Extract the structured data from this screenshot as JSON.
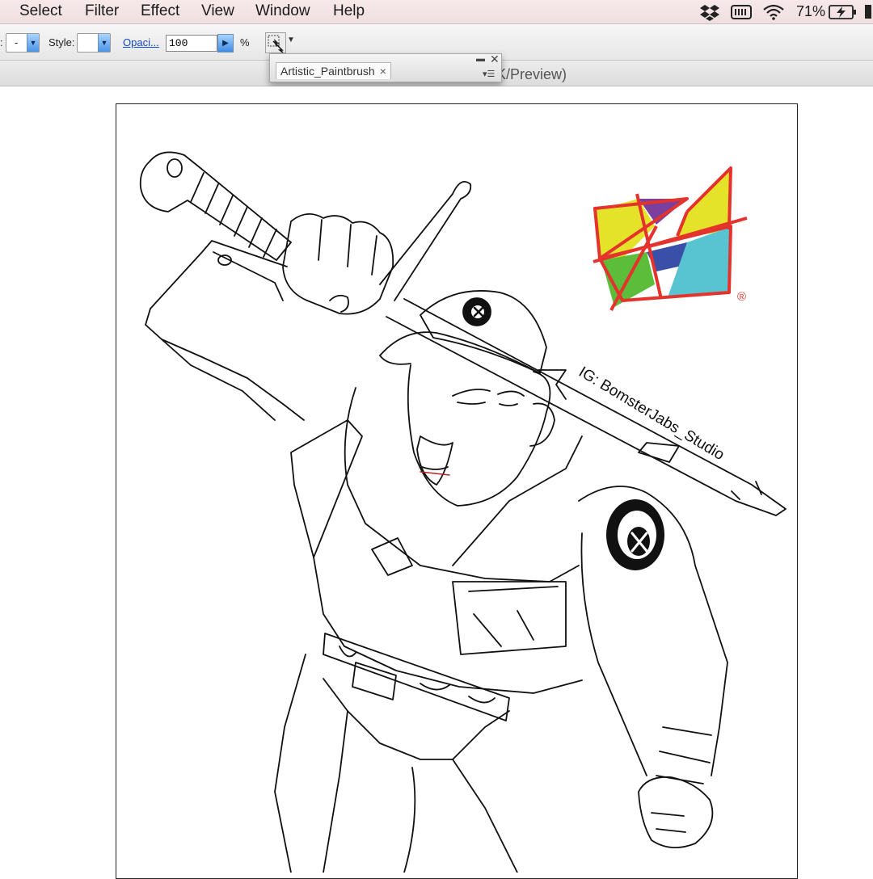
{
  "menubar": {
    "items": [
      "Select",
      "Filter",
      "Effect",
      "View",
      "Window",
      "Help"
    ],
    "status": {
      "icons": [
        "dropbox-icon",
        "keyboard-icon",
        "wifi-icon",
        "battery-charging-icon"
      ],
      "battery_percent": "71%"
    }
  },
  "control_bar": {
    "first_dropdown_value": "-",
    "style_label": "Style:",
    "opacity_label": "Opaci...",
    "opacity_value": "100",
    "opacity_unit": "%"
  },
  "document": {
    "title_fragment": "YK/Preview)"
  },
  "brush_panel": {
    "tab_label": "Artistic_Paintbrush",
    "close_glyph": "×"
  },
  "artwork": {
    "watermark_text": "IG: BomsterJabs_Studio",
    "registered_mark": "®",
    "logo_colors": [
      "#e5e22a",
      "#7b3f9e",
      "#5cbd3b",
      "#3a4fa8",
      "#58c3d1",
      "#e4332c"
    ]
  }
}
